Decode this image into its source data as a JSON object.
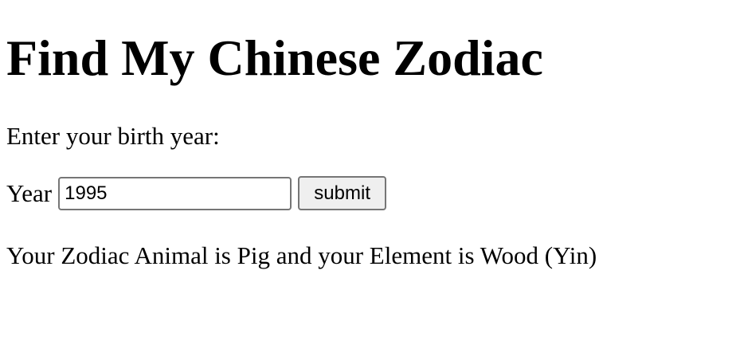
{
  "page": {
    "title": "Find My Chinese Zodiac",
    "prompt": "Enter your birth year:"
  },
  "form": {
    "year_label": "Year",
    "year_value": "1995",
    "submit_label": "submit"
  },
  "result": {
    "text": "Your Zodiac Animal is Pig and your Element is Wood (Yin)"
  }
}
